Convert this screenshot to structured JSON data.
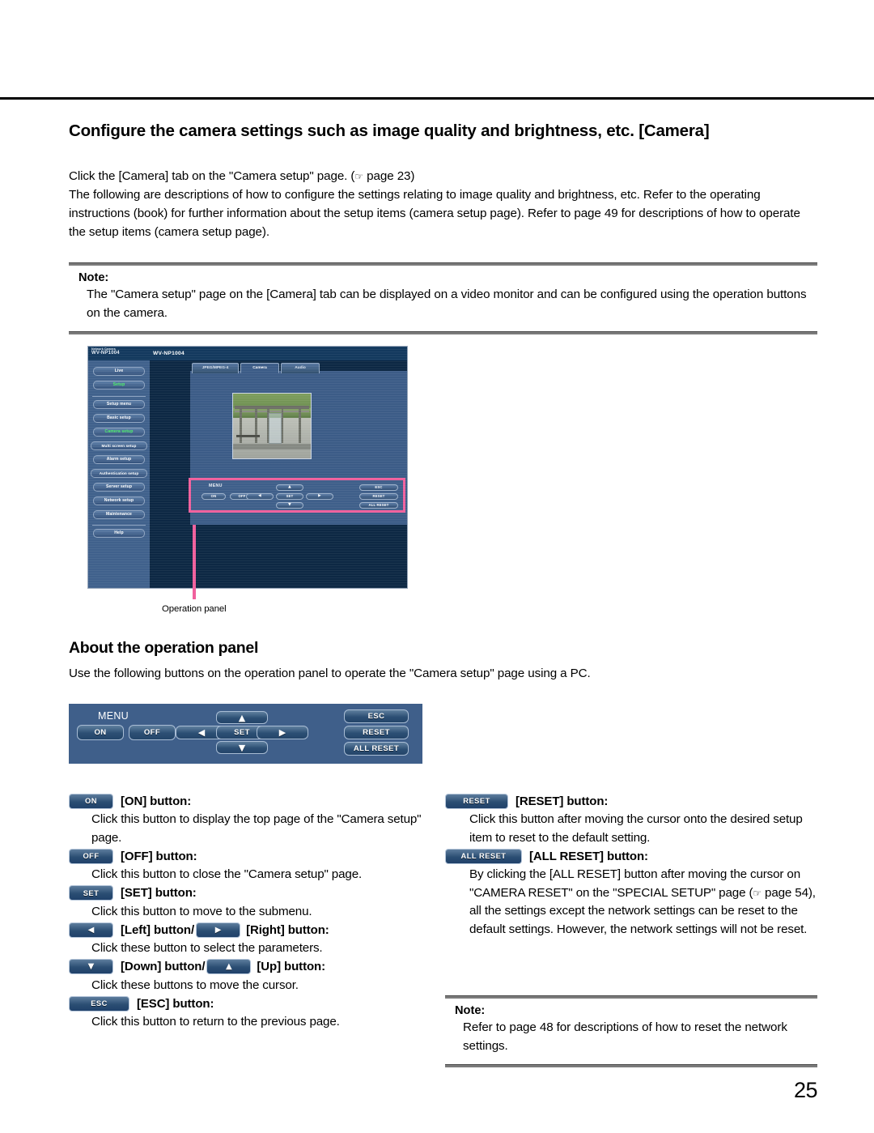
{
  "page_number": "25",
  "heading": "Configure the camera settings such as image quality and brightness, etc. [Camera]",
  "intro": {
    "line1_pre": "Click the [Camera] tab on the \"Camera setup\" page. (",
    "line1_post": " page 23)",
    "pointer_glyph": "☞",
    "paragraph": "The following are descriptions of how to configure the settings relating to image quality and brightness, etc. Refer to the operating instructions (book) for further information about the setup items (camera setup page). Refer to page 49 for descriptions of how to operate the setup items (camera setup page)."
  },
  "note_top": {
    "label": "Note:",
    "text": "The \"Camera setup\" page on the [Camera] tab can be displayed on a video monitor and can be configured using the operation buttons on the camera."
  },
  "screenshot": {
    "brand_small": "Network Camera",
    "brand_model": "WV-NP1004",
    "title_model": "WV-NP1004",
    "sidebar": [
      {
        "label": "Live",
        "state": "normal"
      },
      {
        "label": "Setup",
        "state": "selected"
      },
      {
        "label": "Setup menu",
        "state": "header"
      },
      {
        "label": "Basic setup",
        "state": "normal"
      },
      {
        "label": "Camera setup",
        "state": "selected"
      },
      {
        "label": "Multi screen setup",
        "state": "normal"
      },
      {
        "label": "Alarm setup",
        "state": "normal"
      },
      {
        "label": "Authentication setup",
        "state": "normal"
      },
      {
        "label": "Server setup",
        "state": "normal"
      },
      {
        "label": "Network setup",
        "state": "normal"
      },
      {
        "label": "Maintenance",
        "state": "normal"
      },
      {
        "label": "Help",
        "state": "normal"
      }
    ],
    "tabs": [
      {
        "label": "JPEG/MPEG-4",
        "active": false
      },
      {
        "label": "Camera",
        "active": true
      },
      {
        "label": "Audio",
        "active": false
      }
    ],
    "panel": {
      "menu_label": "MENU",
      "on": "ON",
      "off": "OFF",
      "set": "SET",
      "up": "▲",
      "down": "▼",
      "left": "◀",
      "right": "▶",
      "esc": "ESC",
      "reset": "RESET",
      "all_reset": "ALL RESET"
    },
    "callout_color": "#f0609d",
    "caption": "Operation panel"
  },
  "section2": {
    "heading": "About the operation panel",
    "subtext": "Use the following buttons on the operation panel to operate the \"Camera setup\" page using a PC."
  },
  "operation_panel": {
    "menu_label": "MENU",
    "on": "ON",
    "off": "OFF",
    "set": "SET",
    "up": "▲",
    "down": "▼",
    "left": "◀",
    "right": "▶",
    "esc": "ESC",
    "reset": "RESET",
    "all_reset": "ALL RESET"
  },
  "left_items": [
    {
      "btn": "ON",
      "btn_kind": "text",
      "btn_w": "55",
      "label": "[ON] button:",
      "desc": "Click this button to display the top page of the \"Camera setup\" page."
    },
    {
      "btn": "OFF",
      "btn_kind": "text",
      "btn_w": "55",
      "label": "[OFF] button:",
      "desc": "Click this button to close the \"Camera setup\" page."
    },
    {
      "btn": "SET",
      "btn_kind": "text",
      "btn_w": "55",
      "label": "[SET] button:",
      "desc": "Click this button to move to the submenu."
    },
    {
      "btn": "◀",
      "btn_kind": "arrow",
      "btn_w": "55",
      "label": "[Left] button/",
      "btn2": "▶",
      "btn2_kind": "arrow",
      "btn2_w": "55",
      "label2": "[Right] button:",
      "desc": "Click these button to select the parameters."
    },
    {
      "btn": "▼",
      "btn_kind": "arrow",
      "btn_w": "55",
      "label": "[Down] button/",
      "btn2": "▲",
      "btn2_kind": "arrow",
      "btn2_w": "55",
      "label2": "[Up] button:",
      "desc": "Click these buttons to move the cursor."
    },
    {
      "btn": "ESC",
      "btn_kind": "text",
      "btn_w": "75",
      "label": "[ESC] button:",
      "desc": "Click this button to return to the previous page."
    }
  ],
  "right_items": [
    {
      "btn": "RESET",
      "btn_kind": "text",
      "btn_w": "78",
      "label": "[RESET] button:",
      "desc": "Click this button after moving the cursor onto the desired setup item to reset to the default setting."
    },
    {
      "btn": "ALL RESET",
      "btn_kind": "text",
      "btn_w": "95",
      "label": "[ALL RESET] button:",
      "desc_pre": "By clicking the [ALL RESET] button after moving the cursor on \"CAMERA RESET\" on the \"SPECIAL SETUP\" page (",
      "desc_post": " page 54), all the settings except the network settings can be reset to the default settings. However, the network settings will not be reset."
    }
  ],
  "note_bottom": {
    "label": "Note:",
    "text": "Refer to page 48 for descriptions of how to reset the network settings."
  }
}
